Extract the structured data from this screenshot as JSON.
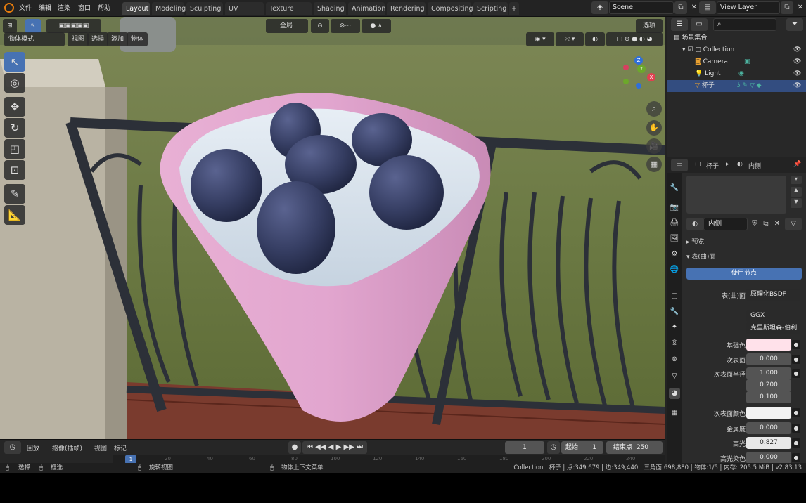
{
  "topbar": {
    "menus": [
      "文件",
      "编辑",
      "渲染",
      "窗口",
      "帮助"
    ],
    "tabs": [
      "Layout",
      "Modeling",
      "Sculpting",
      "UV Editing",
      "Texture Paint",
      "Shading",
      "Animation",
      "Rendering",
      "Compositing",
      "Scripting"
    ],
    "active_tab": "Layout",
    "add_tab": "+",
    "scene_value": "Scene",
    "viewlayer_value": "View Layer"
  },
  "viewport": {
    "mode": "物体模式",
    "menus": [
      "视图",
      "选择",
      "添加",
      "物体"
    ],
    "orientation": "全局",
    "options": "选项",
    "tools": [
      "select-box",
      "cursor",
      "move",
      "rotate",
      "scale",
      "transform",
      "annotate",
      "measure"
    ],
    "colors": {
      "cup": "#e2a6cf",
      "berry": "#3a4266",
      "liquid": "#d7e3ee",
      "rail": "#2c3038"
    }
  },
  "outliner": {
    "search_placeholder": "",
    "scene_collection": "场景集合",
    "items": [
      {
        "name": "Collection",
        "indent": 1
      },
      {
        "name": "Camera",
        "indent": 2
      },
      {
        "name": "Light",
        "indent": 2
      },
      {
        "name": "杯子",
        "indent": 2
      }
    ]
  },
  "properties": {
    "breadcrumb_object": "杯子",
    "breadcrumb_material": "内侧",
    "material_name": "内侧",
    "preview_label": "预览",
    "surface_section": "表(曲)面",
    "use_nodes": "使用节点",
    "surface_label": "表(曲)面",
    "surface_value": "原理化BSDF",
    "distribution": "GGX",
    "subsurface_method": "克里斯坦森-伯利",
    "rows": [
      {
        "label": "基础色",
        "value": ""
      },
      {
        "label": "次表面",
        "value": "0.000"
      },
      {
        "label": "次表面半径",
        "value": "1.000"
      },
      {
        "label": "",
        "value": "0.200"
      },
      {
        "label": "",
        "value": "0.100"
      },
      {
        "label": "次表面颜色",
        "value": ""
      },
      {
        "label": "金属度",
        "value": "0.000"
      },
      {
        "label": "高光",
        "value": "0.827"
      },
      {
        "label": "高光染色",
        "value": "0.000"
      }
    ],
    "base_color": "#ffe1ea",
    "subsurface_color": "#f2f2f2"
  },
  "timeline": {
    "playback": "回放",
    "keying": "抠像(插帧)",
    "view": "视图",
    "marker": "标记",
    "current_frame": "1",
    "start_label": "起始",
    "start_value": "1",
    "end_label": "结束点",
    "end_value": "250",
    "ruler": [
      "1",
      "20",
      "40",
      "60",
      "80",
      "100",
      "120",
      "140",
      "160",
      "180",
      "200",
      "220",
      "240"
    ]
  },
  "status": {
    "select": "选择",
    "box": "框选",
    "rotate": "旋转视图",
    "context": "物体上下文菜单",
    "info": "Collection | 杯子 | 点:349,679 | 边:349,440 | 三角面:698,880 | 物体:1/5 | 内存: 205.5 MiB | v2.83.13"
  }
}
